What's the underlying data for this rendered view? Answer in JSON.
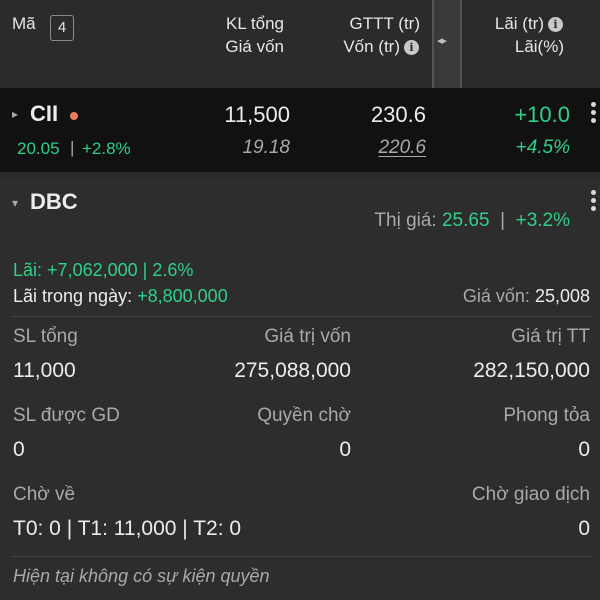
{
  "header": {
    "col_code": "Mã",
    "badge": "4",
    "col_qty_line1": "KL tổng",
    "col_qty_line2": "Giá vốn",
    "col_mv_line1": "GTTT (tr)",
    "col_mv_line2": "Vốn (tr)",
    "col_pl_line1": "Lãi (tr)",
    "col_pl_line2": "Lãi(%)",
    "resize_glyph": "◂▸"
  },
  "cii": {
    "symbol": "CII",
    "price": "20.05",
    "change_pct": "+2.8%",
    "qty": "11,500",
    "avg_cost": "19.18",
    "market_value": "230.6",
    "capital": "220.6",
    "profit": "+10.0",
    "profit_pct": "+4.5%"
  },
  "dbc": {
    "symbol": "DBC",
    "market_price_label": "Thị giá:",
    "market_price": "25.65",
    "market_change": "+3.2%",
    "profit_label": "Lãi:",
    "profit_value": "+7,062,000 | 2.6%",
    "intraday_label": "Lãi trong ngày:",
    "intraday_value": "+8,800,000",
    "cost_label": "Giá vốn:",
    "cost_value": "25,008",
    "total_qty_label": "SL tổng",
    "total_qty": "11,000",
    "capital_label": "Giá trị vốn",
    "capital": "275,088,000",
    "mv_label": "Giá trị TT",
    "mv": "282,150,000",
    "tradable_label": "SL được GD",
    "tradable": "0",
    "rights_label": "Quyền chờ",
    "rights": "0",
    "blocked_label": "Phong tỏa",
    "blocked": "0",
    "incoming_label": "Chờ về",
    "incoming": "T0: 0 | T1: 11,000 | T2: 0",
    "pending_label": "Chờ giao dịch",
    "pending": "0",
    "no_events": "Hiện tại không có sự kiện quyền"
  },
  "colors": {
    "positive": "#2fd08a",
    "alert_dot": "#ee7c5a"
  }
}
